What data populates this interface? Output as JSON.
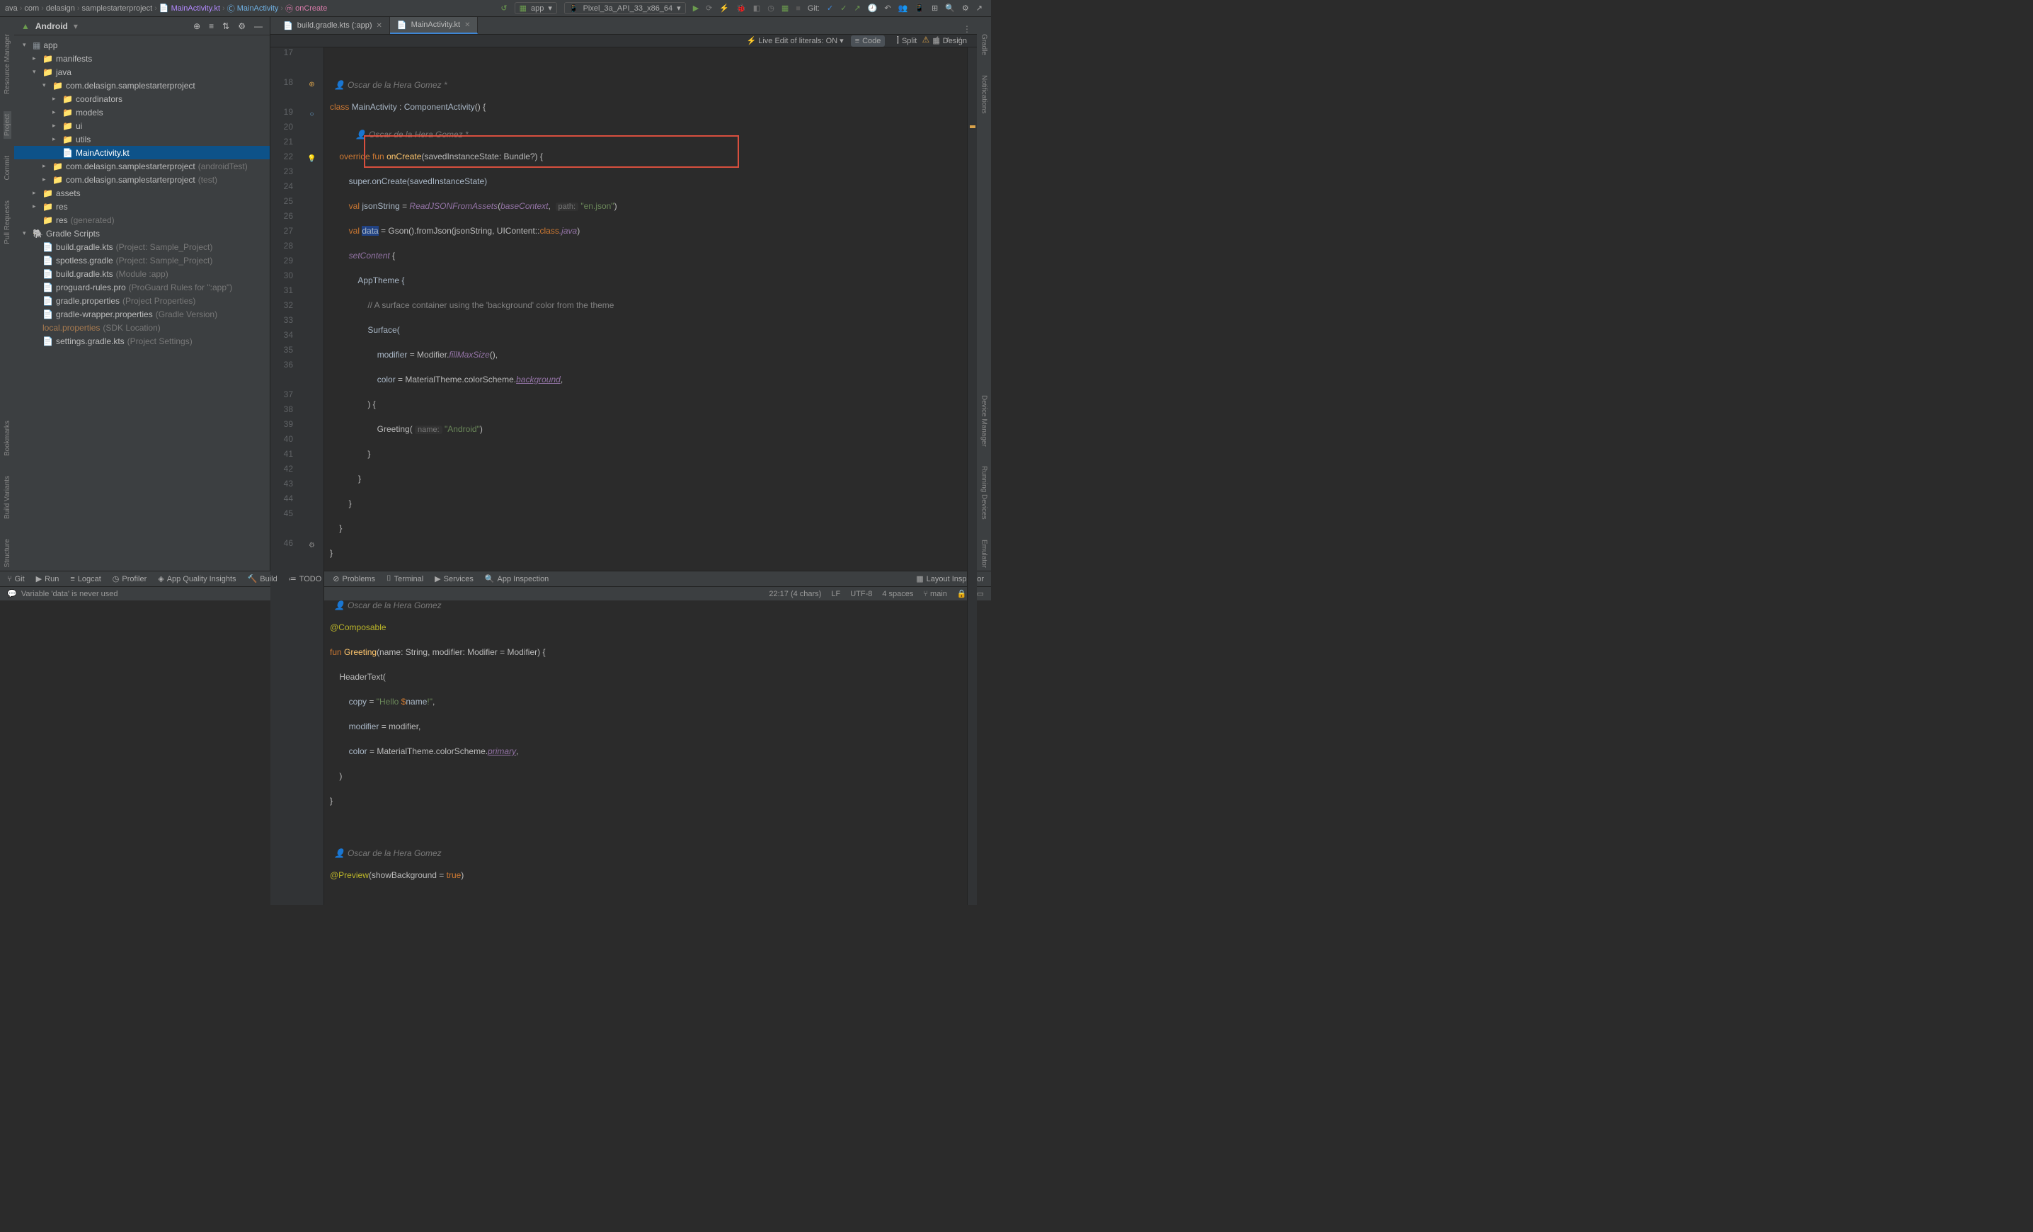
{
  "breadcrumbs": [
    "ava",
    "com",
    "delasign",
    "samplestarterproject",
    "MainActivity.kt",
    "MainActivity",
    "onCreate"
  ],
  "run_config": "app",
  "device": "Pixel_3a_API_33_x86_64",
  "git_label": "Git:",
  "sidebar": {
    "title": "Android"
  },
  "tree": {
    "app": "app",
    "manifests": "manifests",
    "java": "java",
    "pkg1": "com.delasign.samplestarterproject",
    "coordinators": "coordinators",
    "models": "models",
    "ui": "ui",
    "utils": "utils",
    "mainactivity": "MainActivity.kt",
    "pkg2": "com.delasign.samplestarterproject",
    "pkg2_suffix": "(androidTest)",
    "pkg3": "com.delasign.samplestarterproject",
    "pkg3_suffix": "(test)",
    "assets": "assets",
    "res": "res",
    "res_gen": "res",
    "res_gen_suffix": "(generated)",
    "gradle_scripts": "Gradle Scripts",
    "bg1": "build.gradle.kts",
    "bg1_suffix": "(Project: Sample_Project)",
    "spotless": "spotless.gradle",
    "spotless_suffix": "(Project: Sample_Project)",
    "bg2": "build.gradle.kts",
    "bg2_suffix": "(Module :app)",
    "proguard": "proguard-rules.pro",
    "proguard_suffix": "(ProGuard Rules for \":app\")",
    "gp": "gradle.properties",
    "gp_suffix": "(Project Properties)",
    "gwp": "gradle-wrapper.properties",
    "gwp_suffix": "(Gradle Version)",
    "lp": "local.properties",
    "lp_suffix": "(SDK Location)",
    "settings": "settings.gradle.kts",
    "settings_suffix": "(Project Settings)"
  },
  "tabs": [
    {
      "label": "build.gradle.kts (:app)",
      "active": false
    },
    {
      "label": "MainActivity.kt",
      "active": true
    }
  ],
  "live_edit": "Live Edit of literals: ON",
  "viewmodes": {
    "code": "Code",
    "split": "Split",
    "design": "Design"
  },
  "inspections": {
    "warnings": "1"
  },
  "line_numbers": [
    "17",
    "",
    "18",
    "",
    "19",
    "20",
    "21",
    "22",
    "23",
    "24",
    "25",
    "26",
    "27",
    "28",
    "29",
    "30",
    "31",
    "32",
    "33",
    "34",
    "35",
    "36",
    "",
    "37",
    "38",
    "39",
    "40",
    "41",
    "42",
    "43",
    "44",
    "45",
    "",
    "46"
  ],
  "annotations": {
    "a1": "Oscar de la Hera Gomez *",
    "a2": "Oscar de la Hera Gomez *",
    "a3": "Oscar de la Hera Gomez",
    "a4": "Oscar de la Hera Gomez"
  },
  "code": {
    "l18_class": "class",
    "l18_main": "MainActivity",
    "l18_colon": " : ",
    "l18_comp": "ComponentActivity",
    "l18_paren": "() {",
    "l19_override": "override",
    "l19_fun": "fun",
    "l19_onCreate": "onCreate",
    "l19_sig": "(savedInstanceState: Bundle?) {",
    "l20": "        super.onCreate(savedInstanceState)",
    "l21_val": "val",
    "l21_js": "jsonString",
    "l21_eq": " = ",
    "l21_read": "ReadJSONFromAssets",
    "l21_open": "(",
    "l21_base": "baseContext",
    "l21_comma": ", ",
    "l21_hint": "path:",
    "l21_str": "\"en.json\"",
    "l21_close": ")",
    "l22_val": "val",
    "l22_data": "data",
    "l22_eq": " = Gson().fromJson(jsonString, UIContent::",
    "l22_class": "class",
    "l22_java": ".java",
    "l22_close": ")",
    "l23_set": "setContent",
    "l23_brace": " {",
    "l24": "            AppTheme {",
    "l25_comment": "// A surface container using the 'background' color from the theme",
    "l26": "                Surface(",
    "l27_mod": "modifier",
    "l27_eq": " = Modifier.",
    "l27_fill": "fillMaxSize",
    "l27_end": "(),",
    "l28_col": "color",
    "l28_eq": " = MaterialTheme.colorScheme.",
    "l28_bg": "background",
    "l28_comma": ",",
    "l29": "                ) {",
    "l30_greet": "                    Greeting(",
    "l30_hint": "name:",
    "l30_str": " \"Android\"",
    "l30_close": ")",
    "l31": "                }",
    "l32": "            }",
    "l33": "        }",
    "l34": "    }",
    "l35": "}",
    "l37_anno": "@Composable",
    "l38_fun": "fun",
    "l38_greet": "Greeting",
    "l38_sig": "(name: String, modifier: Modifier = Modifier) {",
    "l39": "    HeaderText(",
    "l40_copy": "copy",
    "l40_eq": " = ",
    "l40_str1": "\"Hello ",
    "l40_dollar": "$",
    "l40_name": "name",
    "l40_str2": "!\"",
    "l40_comma": ",",
    "l41_mod": "modifier",
    "l41_eq": " = modifier,",
    "l42_col": "color",
    "l42_eq": " = MaterialTheme.colorScheme.",
    "l42_prim": "primary",
    "l42_comma": ",",
    "l43": "    )",
    "l44": "}",
    "l46_anno": "@Preview",
    "l46_sig": "(showBackground = ",
    "l46_true": "true",
    "l46_close": ")"
  },
  "tool_windows": {
    "git": "Git",
    "run": "Run",
    "logcat": "Logcat",
    "profiler": "Profiler",
    "aqi": "App Quality Insights",
    "build": "Build",
    "todo": "TODO",
    "problems": "Problems",
    "terminal": "Terminal",
    "services": "Services",
    "app_inspection": "App Inspection",
    "layout_inspector": "Layout Inspector"
  },
  "status": {
    "message": "Variable 'data' is never used",
    "pos": "22:17 (4 chars)",
    "eol": "LF",
    "enc": "UTF-8",
    "indent": "4 spaces",
    "branch": "main"
  }
}
